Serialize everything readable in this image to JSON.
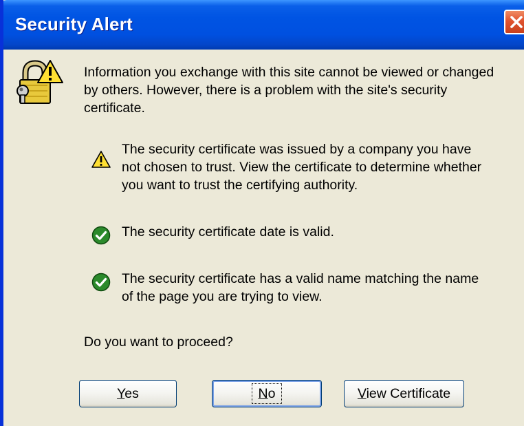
{
  "window": {
    "title": "Security Alert",
    "close_icon": "close-icon"
  },
  "dialog": {
    "main_icon": "padlock-warning-icon",
    "intro": "Information you exchange with this site cannot be viewed or changed by others. However, there is a problem with the site's security certificate.",
    "items": [
      {
        "icon": "warning-icon",
        "lines": [
          "The security certificate was issued by a company you have",
          "not chosen to trust. View the certificate to determine whether",
          "you want to trust the certifying authority."
        ]
      },
      {
        "icon": "check-icon",
        "lines": [
          "The security certificate date is valid."
        ]
      },
      {
        "icon": "check-icon",
        "lines": [
          "The security certificate has a valid name matching the name",
          "of the page you are trying to view."
        ]
      }
    ],
    "question": "Do you want to proceed?"
  },
  "buttons": {
    "yes_label": "Yes",
    "yes_access_key": "Y",
    "yes_rest": "es",
    "no_label": "No",
    "no_access_key": "N",
    "no_rest": "o",
    "view_label": "View Certificate",
    "view_access_key": "V",
    "view_rest": "iew Certificate"
  },
  "colors": {
    "titlebar": "#0054e3",
    "dialog_bg": "#ece9d8",
    "close_button": "#e0532e",
    "check_green": "#2b8a2b",
    "warning_yellow": "#ffe033"
  }
}
